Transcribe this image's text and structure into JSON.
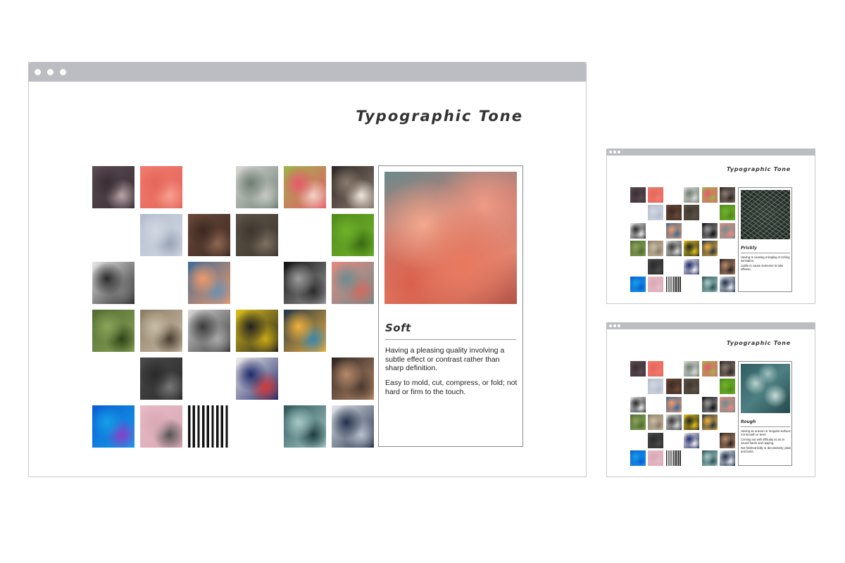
{
  "main_window": {
    "title": "Typographic Tone",
    "card": {
      "word": "Soft",
      "definitions": [
        "Having a pleasing quality involving a subtle effect or contrast rather than sharp definition.",
        "Easy to mold, cut, compress, or fold; not hard or firm to the touch."
      ]
    },
    "tiles": [
      {
        "name": "tile-cactus-spines",
        "row": 0,
        "col": 0,
        "colors": [
          "#5b4b52",
          "#3a2f35",
          "#b8a4a8"
        ]
      },
      {
        "name": "tile-pink-mesh",
        "row": 0,
        "col": 1,
        "colors": [
          "#f07a6e",
          "#e5675b",
          "#f6a091"
        ]
      },
      {
        "name": "tile-succulent",
        "row": 0,
        "col": 3,
        "colors": [
          "#d9d9d6",
          "#6e7e71",
          "#c6c9c4"
        ]
      },
      {
        "name": "tile-peach",
        "row": 0,
        "col": 4,
        "colors": [
          "#9bb64a",
          "#e85a6c",
          "#f2d3c7"
        ]
      },
      {
        "name": "tile-typewriter",
        "row": 0,
        "col": 5,
        "colors": [
          "#2c2623",
          "#8a7a6e",
          "#efe7dd"
        ]
      },
      {
        "name": "tile-snow-field",
        "row": 1,
        "col": 1,
        "colors": [
          "#b4bccd",
          "#d2d8e2",
          "#9aa4b8"
        ]
      },
      {
        "name": "tile-wood-type",
        "row": 1,
        "col": 2,
        "colors": [
          "#6a4a3a",
          "#3e2a22",
          "#8d6652"
        ]
      },
      {
        "name": "tile-log-rings",
        "row": 1,
        "col": 3,
        "colors": [
          "#5e5448",
          "#3f372f",
          "#7d7061"
        ]
      },
      {
        "name": "tile-moss",
        "row": 1,
        "col": 5,
        "colors": [
          "#4f8a1b",
          "#6fb12a",
          "#3b6b12"
        ]
      },
      {
        "name": "tile-bw-crowd",
        "row": 2,
        "col": 0,
        "colors": [
          "#e8e8e8",
          "#2a2a2a",
          "#7a7a7a"
        ]
      },
      {
        "name": "tile-sunset-sea",
        "row": 2,
        "col": 2,
        "colors": [
          "#3d6a96",
          "#f09a6a",
          "#6b8fb1"
        ]
      },
      {
        "name": "tile-silhouette",
        "row": 2,
        "col": 4,
        "colors": [
          "#0f0f0f",
          "#9c9c9c",
          "#2c2c2c"
        ]
      },
      {
        "name": "tile-pink-clouds",
        "row": 2,
        "col": 5,
        "colors": [
          "#e98a7e",
          "#6d8d8f",
          "#d36a5d"
        ]
      },
      {
        "name": "tile-green-hills",
        "row": 3,
        "col": 0,
        "colors": [
          "#4f6b2f",
          "#8aa35a",
          "#2f4418"
        ]
      },
      {
        "name": "tile-kitchen-tools",
        "row": 3,
        "col": 1,
        "colors": [
          "#8b7b64",
          "#c9bda7",
          "#4a3f31"
        ]
      },
      {
        "name": "tile-bench-couple",
        "row": 3,
        "col": 2,
        "colors": [
          "#d8d8d8",
          "#3a3a3a",
          "#a9a9a9"
        ]
      },
      {
        "name": "tile-yellow-signs",
        "row": 3,
        "col": 3,
        "colors": [
          "#e0c21a",
          "#222222",
          "#c9a914"
        ]
      },
      {
        "name": "tile-leaf-light",
        "row": 3,
        "col": 4,
        "colors": [
          "#1e3548",
          "#f2b03a",
          "#3a86b0"
        ]
      },
      {
        "name": "tile-dark-rock",
        "row": 4,
        "col": 1,
        "colors": [
          "#4a4a4a",
          "#2b2b2b",
          "#777777"
        ]
      },
      {
        "name": "tile-type-specimen",
        "row": 4,
        "col": 3,
        "colors": [
          "#f4f0ec",
          "#1f2a6b",
          "#d23a3a"
        ]
      },
      {
        "name": "tile-hand-light",
        "row": 4,
        "col": 5,
        "colors": [
          "#2a2220",
          "#b78a6a",
          "#4d3a30"
        ]
      },
      {
        "name": "tile-blue-cell",
        "row": 5,
        "col": 0,
        "colors": [
          "#0a5bd6",
          "#14a0e6",
          "#8a3fc8"
        ]
      },
      {
        "name": "tile-pink-wire",
        "row": 5,
        "col": 1,
        "colors": [
          "#e6bcc6",
          "#d9a8b4",
          "#555555"
        ]
      },
      {
        "name": "tile-stripes",
        "row": 5,
        "col": 2,
        "colors": [
          "#111111",
          "#ffffff",
          "#111111"
        ]
      },
      {
        "name": "tile-teal-foam",
        "row": 5,
        "col": 4,
        "colors": [
          "#2b5558",
          "#a8c9c7",
          "#1c3e41"
        ]
      },
      {
        "name": "tile-architecture",
        "row": 5,
        "col": 5,
        "colors": [
          "#e6eaef",
          "#22304a",
          "#b7c0cc"
        ]
      }
    ]
  },
  "small_window_1": {
    "title": "Typographic Tone",
    "card": {
      "word": "Prickly",
      "definitions": [
        "Having or causing a tingling or itching sensation.",
        "Liable to cause someone to take offense."
      ]
    },
    "tiles": [
      {
        "row": 0,
        "col": 0,
        "colors": [
          "#5b4b52",
          "#3a2f35"
        ]
      },
      {
        "row": 0,
        "col": 1,
        "colors": [
          "#f07a6e",
          "#e5675b"
        ]
      },
      {
        "row": 0,
        "col": 3,
        "colors": [
          "#d9d9d6",
          "#6e7e71"
        ]
      },
      {
        "row": 0,
        "col": 4,
        "colors": [
          "#9bb64a",
          "#e85a6c"
        ]
      },
      {
        "row": 0,
        "col": 5,
        "colors": [
          "#2c2623",
          "#8a7a6e"
        ]
      },
      {
        "row": 1,
        "col": 1,
        "colors": [
          "#b4bccd",
          "#d2d8e2"
        ]
      },
      {
        "row": 1,
        "col": 2,
        "colors": [
          "#6a4a3a",
          "#3e2a22"
        ]
      },
      {
        "row": 1,
        "col": 3,
        "colors": [
          "#5e5448",
          "#3f372f"
        ]
      },
      {
        "row": 1,
        "col": 5,
        "colors": [
          "#4f8a1b",
          "#6fb12a"
        ]
      },
      {
        "row": 2,
        "col": 0,
        "colors": [
          "#e8e8e8",
          "#2a2a2a"
        ]
      },
      {
        "row": 2,
        "col": 2,
        "colors": [
          "#3d6a96",
          "#f09a6a"
        ]
      },
      {
        "row": 2,
        "col": 4,
        "colors": [
          "#0f0f0f",
          "#9c9c9c"
        ]
      },
      {
        "row": 2,
        "col": 5,
        "colors": [
          "#e98a7e",
          "#6d8d8f"
        ]
      },
      {
        "row": 3,
        "col": 0,
        "colors": [
          "#4f6b2f",
          "#8aa35a"
        ]
      },
      {
        "row": 3,
        "col": 1,
        "colors": [
          "#8b7b64",
          "#c9bda7"
        ]
      },
      {
        "row": 3,
        "col": 2,
        "colors": [
          "#d8d8d8",
          "#3a3a3a"
        ]
      },
      {
        "row": 3,
        "col": 3,
        "colors": [
          "#e0c21a",
          "#222222"
        ]
      },
      {
        "row": 3,
        "col": 4,
        "colors": [
          "#1e3548",
          "#f2b03a"
        ]
      },
      {
        "row": 4,
        "col": 1,
        "colors": [
          "#4a4a4a",
          "#2b2b2b"
        ]
      },
      {
        "row": 4,
        "col": 3,
        "colors": [
          "#f4f0ec",
          "#1f2a6b"
        ]
      },
      {
        "row": 4,
        "col": 5,
        "colors": [
          "#2a2220",
          "#b78a6a"
        ]
      },
      {
        "row": 5,
        "col": 0,
        "colors": [
          "#0a5bd6",
          "#14a0e6"
        ]
      },
      {
        "row": 5,
        "col": 1,
        "colors": [
          "#e6bcc6",
          "#d9a8b4"
        ]
      },
      {
        "row": 5,
        "col": 2,
        "colors": [
          "#111111",
          "#ffffff"
        ]
      },
      {
        "row": 5,
        "col": 4,
        "colors": [
          "#2b5558",
          "#a8c9c7"
        ]
      },
      {
        "row": 5,
        "col": 5,
        "colors": [
          "#e6eaef",
          "#22304a"
        ]
      }
    ]
  },
  "small_window_2": {
    "title": "Typographic Tone",
    "card": {
      "word": "Rough",
      "definitions": [
        "Having an uneven or irregular surface; not smooth or level.",
        "Coming out with difficulty so as to sound harsh and rasping.",
        "Not finished tidily or decoratively; plain and basic."
      ]
    },
    "tiles": [
      {
        "row": 0,
        "col": 0,
        "colors": [
          "#5b4b52",
          "#3a2f35"
        ]
      },
      {
        "row": 0,
        "col": 1,
        "colors": [
          "#f07a6e",
          "#e5675b"
        ]
      },
      {
        "row": 0,
        "col": 3,
        "colors": [
          "#d9d9d6",
          "#6e7e71"
        ]
      },
      {
        "row": 0,
        "col": 4,
        "colors": [
          "#9bb64a",
          "#e85a6c"
        ]
      },
      {
        "row": 0,
        "col": 5,
        "colors": [
          "#2c2623",
          "#8a7a6e"
        ]
      },
      {
        "row": 1,
        "col": 1,
        "colors": [
          "#b4bccd",
          "#d2d8e2"
        ]
      },
      {
        "row": 1,
        "col": 2,
        "colors": [
          "#6a4a3a",
          "#3e2a22"
        ]
      },
      {
        "row": 1,
        "col": 3,
        "colors": [
          "#5e5448",
          "#3f372f"
        ]
      },
      {
        "row": 1,
        "col": 5,
        "colors": [
          "#4f8a1b",
          "#6fb12a"
        ]
      },
      {
        "row": 2,
        "col": 0,
        "colors": [
          "#e8e8e8",
          "#2a2a2a"
        ]
      },
      {
        "row": 2,
        "col": 2,
        "colors": [
          "#3d6a96",
          "#f09a6a"
        ]
      },
      {
        "row": 2,
        "col": 4,
        "colors": [
          "#0f0f0f",
          "#9c9c9c"
        ]
      },
      {
        "row": 2,
        "col": 5,
        "colors": [
          "#e98a7e",
          "#6d8d8f"
        ]
      },
      {
        "row": 3,
        "col": 0,
        "colors": [
          "#4f6b2f",
          "#8aa35a"
        ]
      },
      {
        "row": 3,
        "col": 1,
        "colors": [
          "#8b7b64",
          "#c9bda7"
        ]
      },
      {
        "row": 3,
        "col": 2,
        "colors": [
          "#d8d8d8",
          "#3a3a3a"
        ]
      },
      {
        "row": 3,
        "col": 3,
        "colors": [
          "#e0c21a",
          "#222222"
        ]
      },
      {
        "row": 3,
        "col": 4,
        "colors": [
          "#1e3548",
          "#f2b03a"
        ]
      },
      {
        "row": 4,
        "col": 1,
        "colors": [
          "#4a4a4a",
          "#2b2b2b"
        ]
      },
      {
        "row": 4,
        "col": 3,
        "colors": [
          "#f4f0ec",
          "#1f2a6b"
        ]
      },
      {
        "row": 4,
        "col": 5,
        "colors": [
          "#2a2220",
          "#b78a6a"
        ]
      },
      {
        "row": 5,
        "col": 0,
        "colors": [
          "#0a5bd6",
          "#14a0e6"
        ]
      },
      {
        "row": 5,
        "col": 1,
        "colors": [
          "#e6bcc6",
          "#d9a8b4"
        ]
      },
      {
        "row": 5,
        "col": 2,
        "colors": [
          "#111111",
          "#ffffff"
        ]
      },
      {
        "row": 5,
        "col": 4,
        "colors": [
          "#2b5558",
          "#a8c9c7"
        ]
      },
      {
        "row": 5,
        "col": 5,
        "colors": [
          "#e6eaef",
          "#22304a"
        ]
      }
    ]
  }
}
